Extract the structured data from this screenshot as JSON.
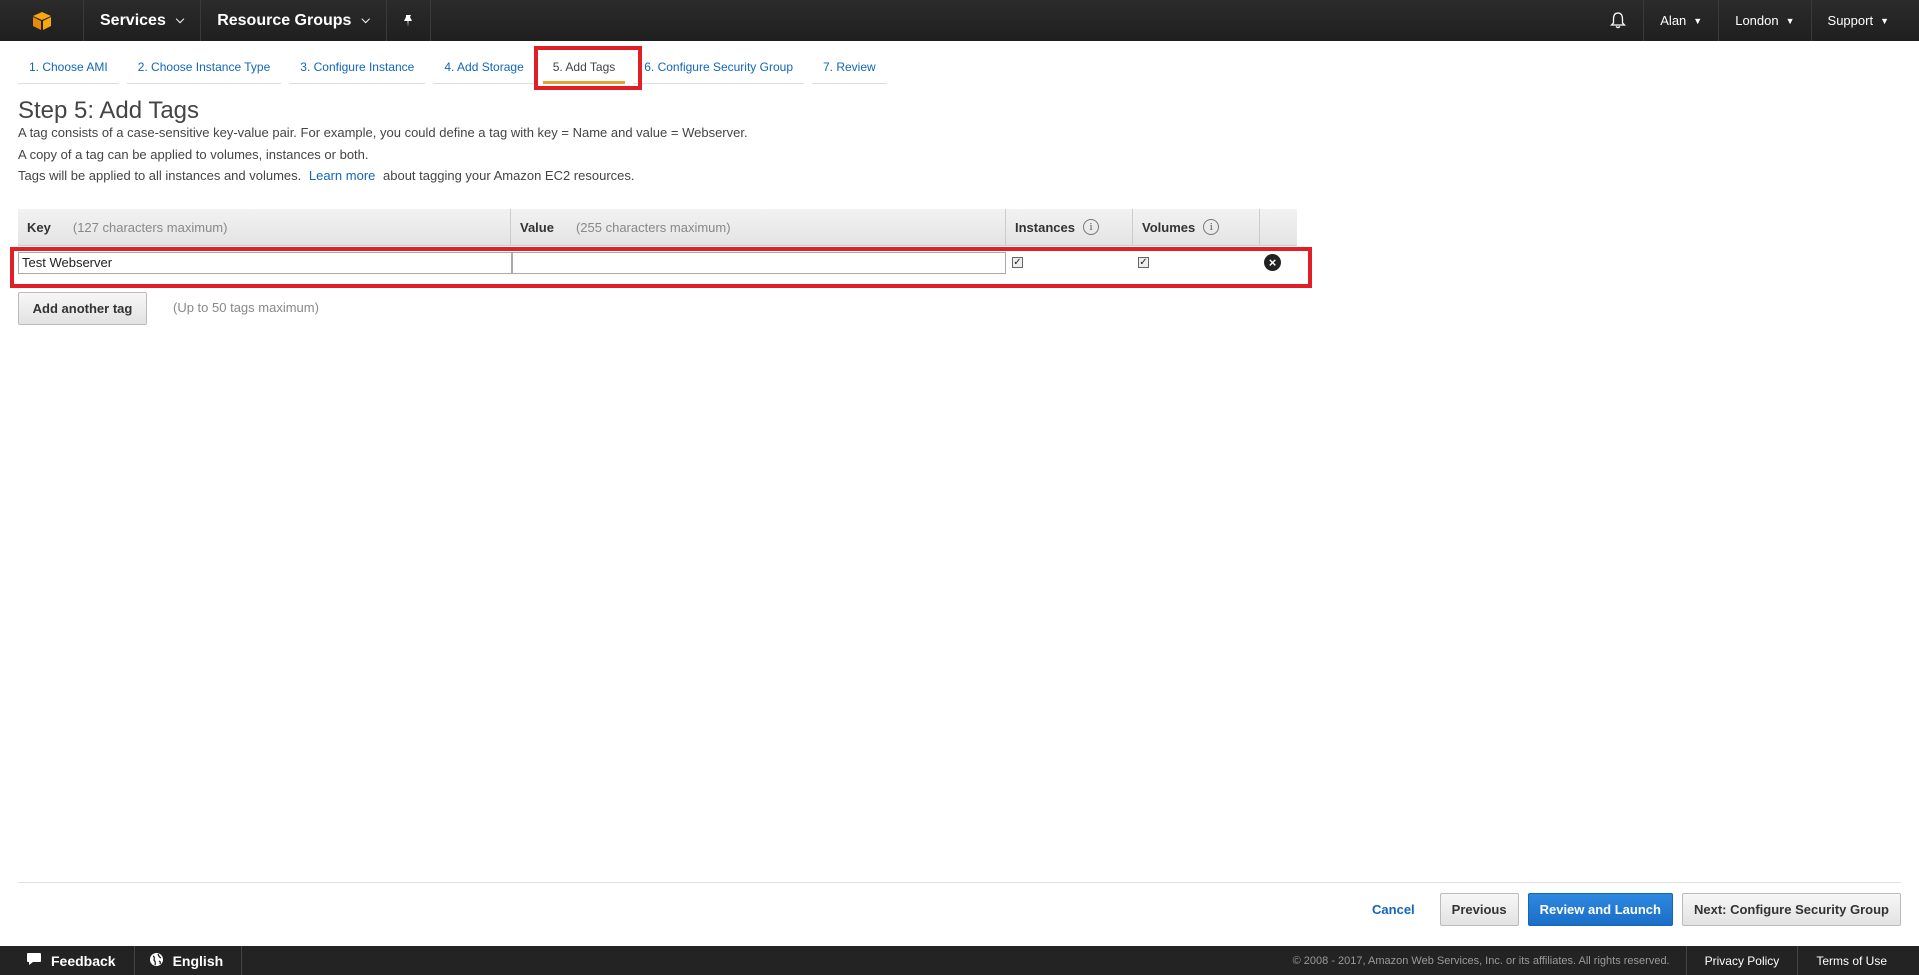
{
  "nav": {
    "services": "Services",
    "resource_groups": "Resource Groups",
    "user": "Alan",
    "region": "London",
    "support": "Support"
  },
  "tabs": [
    {
      "label": "1. Choose AMI"
    },
    {
      "label": "2. Choose Instance Type"
    },
    {
      "label": "3. Configure Instance"
    },
    {
      "label": "4. Add Storage"
    },
    {
      "label": "5. Add Tags"
    },
    {
      "label": "6. Configure Security Group"
    },
    {
      "label": "7. Review"
    }
  ],
  "step": {
    "title": "Step 5: Add Tags",
    "line1": "A tag consists of a case-sensitive key-value pair. For example, you could define a tag with key = Name and value = Webserver.",
    "line2": "A copy of a tag can be applied to volumes, instances or both.",
    "line3_pre": "Tags will be applied to all instances and volumes.",
    "learn_more": "Learn more",
    "line3_post": "about tagging your Amazon EC2 resources."
  },
  "table": {
    "key_header": "Key",
    "key_hint": "(127 characters maximum)",
    "value_header": "Value",
    "value_hint": "(255 characters maximum)",
    "instances_header": "Instances",
    "volumes_header": "Volumes",
    "rows": [
      {
        "key": "Test Webserver",
        "value": "",
        "instances": true,
        "volumes": true
      }
    ]
  },
  "add_tag": {
    "label": "Add another tag",
    "hint": "(Up to 50 tags maximum)"
  },
  "actions": {
    "cancel": "Cancel",
    "previous": "Previous",
    "review_launch": "Review and Launch",
    "next": "Next: Configure Security Group"
  },
  "footer": {
    "feedback": "Feedback",
    "language": "English",
    "copyright": "© 2008 - 2017, Amazon Web Services, Inc. or its affiliates. All rights reserved.",
    "privacy": "Privacy Policy",
    "terms": "Terms of Use"
  },
  "colors": {
    "nav_bg": "#232323",
    "link": "#1166bb",
    "highlight": "#e21e26",
    "tab_active": "#e8a033",
    "primary": "#1a6ec8"
  }
}
